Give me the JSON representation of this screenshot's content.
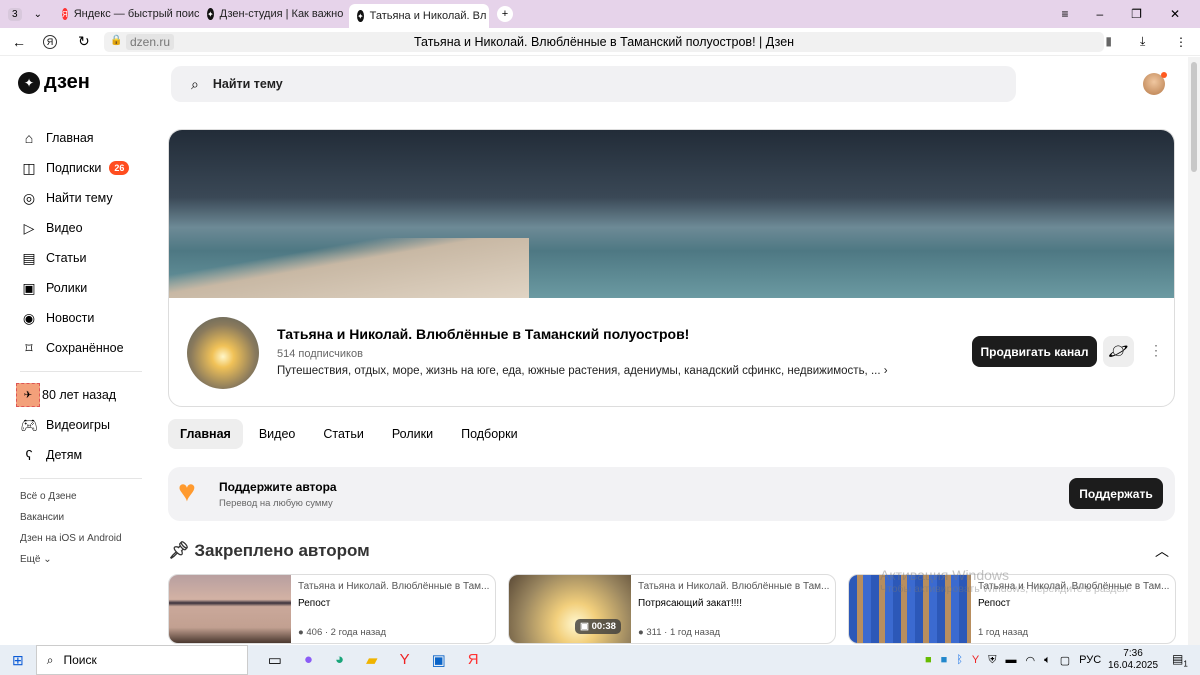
{
  "browser": {
    "tab_count": "3",
    "tabs": [
      {
        "title": "Яндекс — быстрый поиск"
      },
      {
        "title": "Дзен-студия | Как важно"
      },
      {
        "title": "Татьяна и Николай. Вл"
      }
    ],
    "url": "dzen.ru",
    "page_title": "Татьяна и Николай. Влюблённые в Таманский полуостров! | Дзен"
  },
  "header": {
    "logo": "дзен",
    "search_placeholder": "Найти тему"
  },
  "sidebar": {
    "items": [
      {
        "label": "Главная",
        "icon": "home-icon"
      },
      {
        "label": "Подписки",
        "icon": "subscriptions-icon",
        "badge": "26"
      },
      {
        "label": "Найти тему",
        "icon": "compass-icon"
      },
      {
        "label": "Видео",
        "icon": "video-icon"
      },
      {
        "label": "Статьи",
        "icon": "articles-icon"
      },
      {
        "label": "Ролики",
        "icon": "shorts-icon"
      },
      {
        "label": "Новости",
        "icon": "news-icon"
      },
      {
        "label": "Сохранённое",
        "icon": "bookmark-icon"
      }
    ],
    "items2": [
      {
        "label": "80 лет назад"
      },
      {
        "label": "Видеоигры"
      },
      {
        "label": "Детям"
      }
    ],
    "links": [
      "Всё о Дзене",
      "Вакансии",
      "Дзен на iOS и Android",
      "Ещё"
    ]
  },
  "channel": {
    "name": "Татьяна и Николай. Влюблённые в Таманский полуостров!",
    "subscribers": "514 подписчиков",
    "description": "Путешествия, отдых, море, жизнь на юге, еда, южные растения, адениумы, канадский сфинкс, недвижимость, ...",
    "promote_label": "Продвигать канал"
  },
  "tabs": [
    "Главная",
    "Видео",
    "Статьи",
    "Ролики",
    "Подборки"
  ],
  "support": {
    "title": "Поддержите автора",
    "subtitle": "Перевод на любую сумму",
    "button": "Поддержать"
  },
  "pinned": {
    "title": "Закреплено автором",
    "cards": [
      {
        "author": "Татьяна и Николай. Влюблённые в Там...",
        "title": "Репост",
        "meta": "406 · 2 года назад"
      },
      {
        "author": "Татьяна и Николай. Влюблённые в Там...",
        "title": "Потрясающий закат!!!!",
        "meta": "311 · 1 год назад",
        "duration": "00:38"
      },
      {
        "author": "Татьяна и Николай. Влюблённые в Там...",
        "title": "Репост",
        "meta": "1 год назад"
      }
    ]
  },
  "watermark": {
    "line1": "Активация Windows",
    "line2": "Чтобы активировать Windows, перейдите в раздел"
  },
  "taskbar": {
    "search": "Поиск",
    "lang": "РУС",
    "time": "7:36",
    "date": "16.04.2025",
    "notif": "1"
  }
}
